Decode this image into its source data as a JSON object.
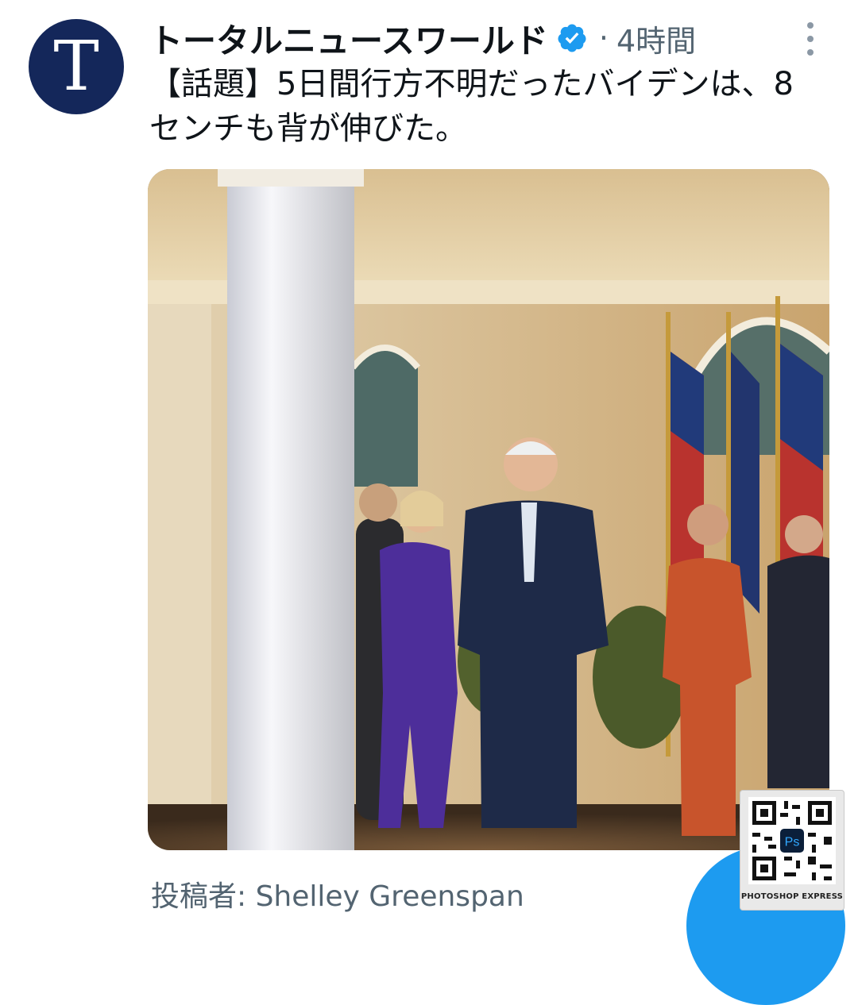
{
  "tweet": {
    "avatar_letter": "T",
    "display_name": "トータルニュースワールド",
    "verified_icon": "verified-badge-icon",
    "separator": "·",
    "timestamp": "4時間",
    "more_icon": "more-options-icon",
    "text": "【話題】5日間行方不明だったバイデンは、8センチも背が伸びた。",
    "media_credit": "投稿者: Shelley Greenspan"
  },
  "media": {
    "mute_icon": "speaker-muted-icon"
  },
  "overlay": {
    "badge_label": "PHOTOSHOP EXPRESS",
    "badge_logo_text": "Ps"
  },
  "colors": {
    "avatar_bg": "#14275a",
    "verified": "#1d9bf0",
    "fab": "#1d9bf0",
    "secondary_text": "#536471"
  }
}
